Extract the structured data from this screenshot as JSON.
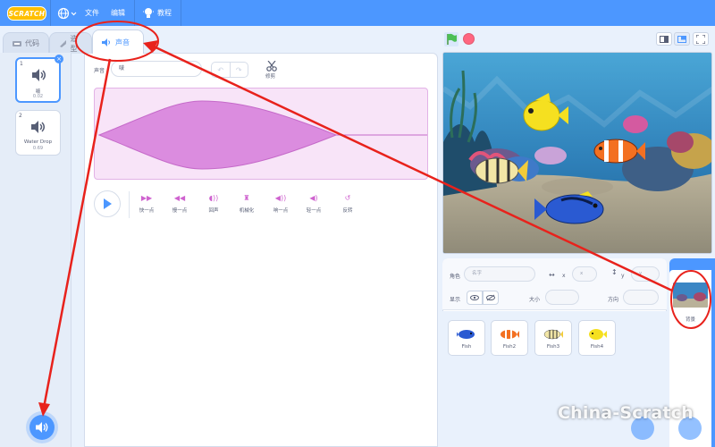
{
  "menubar": {
    "logo": "SCRATCH",
    "items": [
      {
        "label": "文件"
      },
      {
        "label": "编辑"
      },
      {
        "label": "教程"
      }
    ]
  },
  "tabs": [
    {
      "label": "代码"
    },
    {
      "label": "造型"
    },
    {
      "label": "声音"
    }
  ],
  "sounds": [
    {
      "num": "1",
      "name": "啵",
      "duration": "0.02"
    },
    {
      "num": "2",
      "name": "Water Drop",
      "duration": "0.69"
    }
  ],
  "editor": {
    "sound_label": "声音",
    "sound_name": "啵",
    "trim_label": "修剪",
    "effects": [
      {
        "label": "快一点"
      },
      {
        "label": "慢一点"
      },
      {
        "label": "回声"
      },
      {
        "label": "机械化"
      },
      {
        "label": "响一点"
      },
      {
        "label": "轻一点"
      },
      {
        "label": "反转"
      }
    ]
  },
  "sprite_info": {
    "sprite_label": "角色",
    "name_placeholder": "名字",
    "x_placeholder": "x",
    "y_placeholder": "y",
    "x_label": "x",
    "y_label": "y",
    "show_label": "显示",
    "size_label": "大小",
    "direction_label": "方向"
  },
  "sprites": [
    {
      "name": "Fish"
    },
    {
      "name": "Fish2"
    },
    {
      "name": "Fish3"
    },
    {
      "name": "Fish4"
    }
  ],
  "backdrop": {
    "label": "背景"
  },
  "watermark": "China-Scratch",
  "colors": {
    "accent": "#4c97ff",
    "sound_purple": "#cf63cf",
    "annotation_red": "#e8221c"
  }
}
